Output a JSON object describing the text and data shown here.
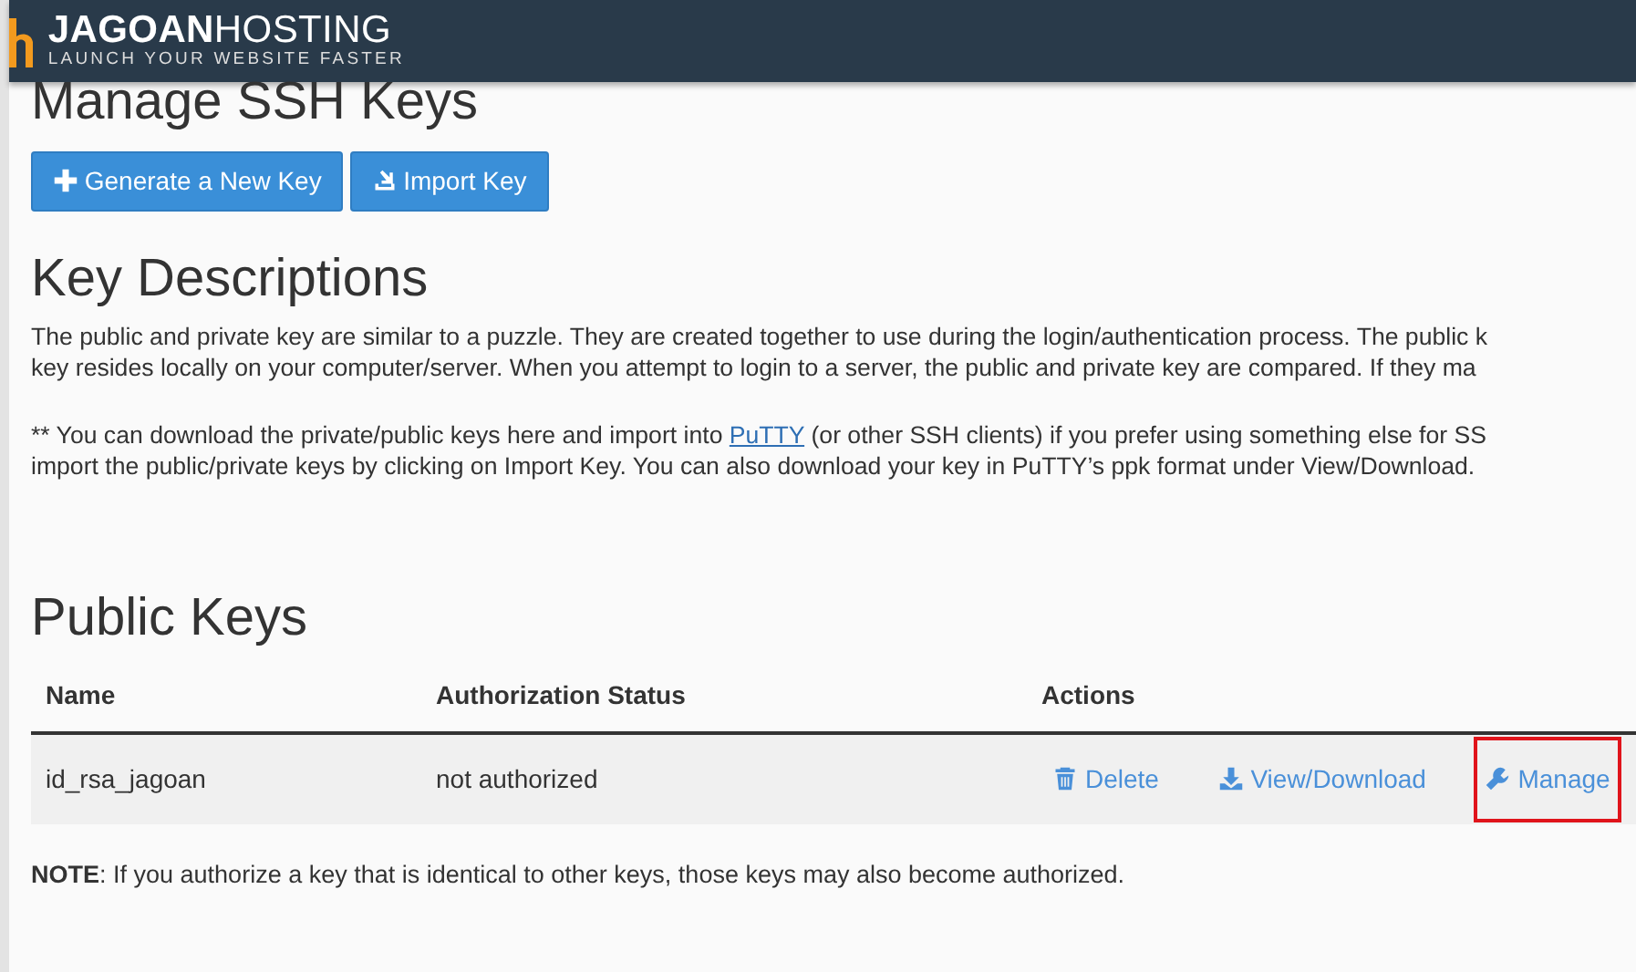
{
  "header": {
    "brand_bold": "JAGOAN",
    "brand_light": "HOSTING",
    "tagline": "LAUNCH YOUR WEBSITE FASTER"
  },
  "title": "Manage SSH Keys",
  "buttons": [
    {
      "label": "Generate a New Key",
      "kind": "plus"
    },
    {
      "label": "Import Key",
      "kind": "import"
    }
  ],
  "descriptions": {
    "heading": "Key Descriptions",
    "paragraph_1": [
      "The public and private key are similar to a puzzle. They are created together to use during the login/authentication process. The public k",
      "key resides locally on your computer/server. When you attempt to login to a server, the public and private key are compared. If they ma"
    ],
    "paragraph_2": {
      "line_1_before": "** You can download the private/public keys here and import into",
      "link": "PuTTY",
      "line_1_after": "(or other SSH clients) if you prefer using something else for SS",
      "line_2": "import the public/private keys by clicking on Import Key. You can also download your key in PuTTY’s ppk format under View/Download."
    }
  },
  "public_keys": {
    "heading": "Public Keys",
    "columns": [
      "Name",
      "Authorization Status",
      "Actions"
    ],
    "rows": [
      {
        "name": "id_rsa_jagoan",
        "status": "not authorized",
        "actions": [
          {
            "label": "Delete",
            "kind": "trash",
            "highlighted": false
          },
          {
            "label": "View/Download",
            "kind": "download",
            "highlighted": false
          },
          {
            "label": "Manage",
            "kind": "wrench",
            "highlighted": true
          }
        ]
      }
    ]
  },
  "note": "**NOTE**: If you authorize a key that is identical to other keys, those keys may also become authorized."
}
